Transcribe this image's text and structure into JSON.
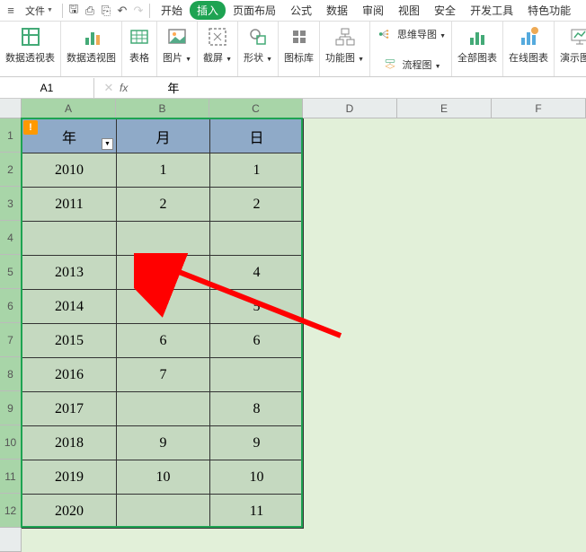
{
  "toolbar": {
    "file_menu": "文件",
    "tabs": [
      "开始",
      "插入",
      "页面布局",
      "公式",
      "数据",
      "审阅",
      "视图",
      "安全",
      "开发工具",
      "特色功能"
    ],
    "active_tab_index": 1
  },
  "ribbon": {
    "groups": [
      {
        "label": "数据透视表",
        "big": true,
        "icon": "pivot-table"
      },
      {
        "label": "数据透视图",
        "big": true,
        "icon": "pivot-chart"
      },
      {
        "label": "表格",
        "big": true,
        "icon": "table"
      },
      {
        "label": "图片",
        "big": true,
        "icon": "picture",
        "dropdown": true
      },
      {
        "label": "截屏",
        "big": true,
        "icon": "screenshot",
        "dropdown": true
      },
      {
        "label": "形状",
        "big": true,
        "icon": "shapes",
        "dropdown": true
      },
      {
        "label": "图标库",
        "big": true,
        "icon": "icons"
      },
      {
        "label": "功能图",
        "big": true,
        "icon": "diagram",
        "dropdown": true
      },
      {
        "label": "思维导图",
        "icon": "mindmap",
        "dropdown": true
      },
      {
        "label": "流程图",
        "icon": "flowchart",
        "dropdown": true
      },
      {
        "label": "全部图表",
        "big": true,
        "icon": "chart-all"
      },
      {
        "label": "在线图表",
        "big": true,
        "icon": "chart-online"
      },
      {
        "label": "演示图表",
        "big": true,
        "icon": "chart-present"
      }
    ]
  },
  "namebox": "A1",
  "formula_value": "年",
  "col_headers": {
    "widths": [
      105,
      104,
      104,
      105,
      105,
      105
    ],
    "labels": [
      "A",
      "B",
      "C",
      "D",
      "E",
      "F"
    ],
    "selected": [
      0,
      1,
      2
    ]
  },
  "row_headers": {
    "heights": [
      38,
      38,
      38,
      38,
      38,
      38,
      38,
      38,
      38,
      38,
      38,
      38,
      27
    ],
    "labels": [
      "1",
      "2",
      "3",
      "4",
      "5",
      "6",
      "7",
      "8",
      "9",
      "10",
      "11",
      "12",
      ""
    ],
    "selected": [
      0,
      1,
      2,
      3,
      4,
      5,
      6,
      7,
      8,
      9,
      10,
      11
    ]
  },
  "chart_data": {
    "type": "table",
    "headers": [
      "年",
      "月",
      "日"
    ],
    "rows": [
      [
        "2010",
        "1",
        "1"
      ],
      [
        "2011",
        "2",
        "2"
      ],
      [
        "",
        "",
        ""
      ],
      [
        "2013",
        "4",
        "4"
      ],
      [
        "2014",
        "5",
        "5"
      ],
      [
        "2015",
        "6",
        "6"
      ],
      [
        "2016",
        "7",
        ""
      ],
      [
        "2017",
        "",
        "8"
      ],
      [
        "2018",
        "9",
        "9"
      ],
      [
        "2019",
        "10",
        "10"
      ],
      [
        "2020",
        "",
        "11"
      ]
    ]
  }
}
